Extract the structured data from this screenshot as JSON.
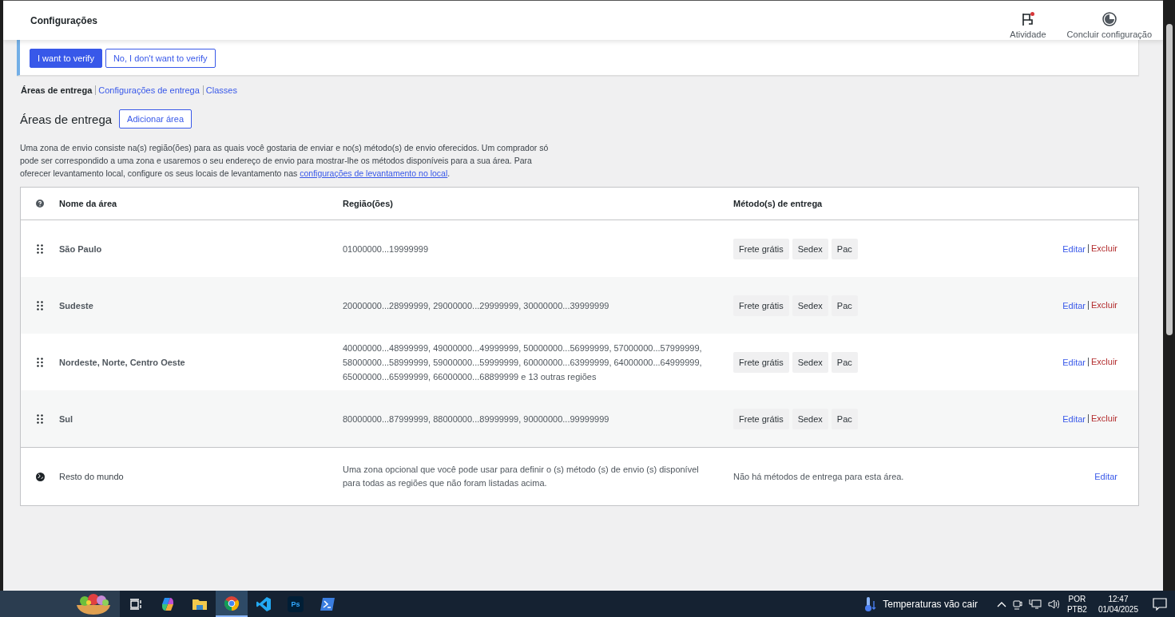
{
  "header": {
    "title": "Configurações",
    "actions": [
      {
        "label": "Atividade",
        "kind": "activity"
      },
      {
        "label": "Concluir configuração",
        "kind": "progress"
      }
    ]
  },
  "notice": {
    "buttons": [
      {
        "label": "I want to verify",
        "kind": "primary"
      },
      {
        "label": "No, I don't want to verify",
        "kind": "secondary"
      }
    ]
  },
  "subnav": [
    {
      "label": "Áreas de entrega",
      "selected": true
    },
    {
      "label": "Configurações de entrega",
      "selected": false
    },
    {
      "label": "Classes",
      "selected": false
    }
  ],
  "section": {
    "heading": "Áreas de entrega",
    "add_button": "Adicionar área",
    "description": "Uma zona de envio consiste na(s) região(ões) para as quais você gostaria de enviar e no(s) método(s) de envio oferecidos. Um comprador só pode ser correspondido a uma zona e usaremos o seu endereço de envio para mostrar-lhe os métodos disponíveis para a sua área. Para oferecer levantamento local, configure os seus locais de levantamento nas ",
    "description_link": "configurações de levantamento no local",
    "description_end": "."
  },
  "table": {
    "columns": [
      {
        "kind": "help"
      },
      {
        "label": "Nome da área",
        "kind": "text"
      },
      {
        "label": "Região(ões)",
        "kind": "text"
      },
      {
        "label": "Método(s) de entrega",
        "kind": "text"
      }
    ],
    "rows": [
      {
        "kind": "zone",
        "name": "São Paulo",
        "regions": "01000000...19999999",
        "methods": [
          "Frete grátis",
          "Sedex",
          "Pac"
        ],
        "actions": [
          {
            "label": "Editar",
            "kind": "edit"
          },
          {
            "label": "Excluir",
            "kind": "delete"
          }
        ]
      },
      {
        "kind": "zone",
        "name": "Sudeste",
        "regions": "20000000...28999999, 29000000...29999999, 30000000...39999999",
        "methods": [
          "Frete grátis",
          "Sedex",
          "Pac"
        ],
        "actions": [
          {
            "label": "Editar",
            "kind": "edit"
          },
          {
            "label": "Excluir",
            "kind": "delete"
          }
        ]
      },
      {
        "kind": "zone",
        "name": "Nordeste, Norte, Centro Oeste",
        "regions": "40000000...48999999, 49000000...49999999, 50000000...56999999, 57000000...57999999, 58000000...58999999, 59000000...59999999, 60000000...63999999, 64000000...64999999, 65000000...65999999, 66000000...68899999 e 13 outras regiões",
        "methods": [
          "Frete grátis",
          "Sedex",
          "Pac"
        ],
        "actions": [
          {
            "label": "Editar",
            "kind": "edit"
          },
          {
            "label": "Excluir",
            "kind": "delete"
          }
        ]
      },
      {
        "kind": "zone",
        "name": "Sul",
        "regions": "80000000...87999999, 88000000...89999999, 90000000...99999999",
        "methods": [
          "Frete grátis",
          "Sedex",
          "Pac"
        ],
        "actions": [
          {
            "label": "Editar",
            "kind": "edit"
          },
          {
            "label": "Excluir",
            "kind": "delete"
          }
        ]
      },
      {
        "kind": "fallback",
        "name": "Resto do mundo",
        "regions": "Uma zona opcional que você pode usar para definir o (s) método (s) de envio (s) disponível para todas as regiões que não foram listadas acima.",
        "note": "Não há métodos de entrega para esta área.",
        "actions": [
          {
            "label": "Editar",
            "kind": "edit"
          }
        ]
      }
    ]
  },
  "taskbar": {
    "apps": [
      {
        "kind": "taskview",
        "selected": false
      },
      {
        "kind": "copilot",
        "selected": false
      },
      {
        "kind": "folder",
        "selected": false
      },
      {
        "kind": "chrome",
        "selected": true
      },
      {
        "kind": "vscode",
        "selected": false
      },
      {
        "kind": "photoshop",
        "label": "Ps",
        "selected": false
      },
      {
        "kind": "terminal",
        "selected": false
      }
    ],
    "weather": "Temperaturas vão cair",
    "language": "POR",
    "layout": "PTB2",
    "time": "12:47",
    "date": "01/04/2025"
  }
}
